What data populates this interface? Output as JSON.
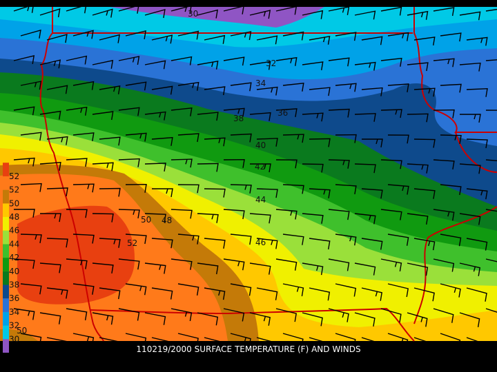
{
  "caption": "110219/2000 SURFACE TEMPERATURE (F) AND WINDS",
  "legend": [
    {
      "value": "30",
      "color": "#8f55c4"
    },
    {
      "value": "30",
      "color": "#00c9e6"
    },
    {
      "value": "32",
      "color": "#00a2e8"
    },
    {
      "value": "34",
      "color": "#2a73d6"
    },
    {
      "value": "36",
      "color": "#0e4a8c"
    },
    {
      "value": "38",
      "color": "#0a7a1e"
    },
    {
      "value": "40",
      "color": "#109a10"
    },
    {
      "value": "42",
      "color": "#3fc02c"
    },
    {
      "value": "44",
      "color": "#9ae03a"
    },
    {
      "value": "46",
      "color": "#f0f000"
    },
    {
      "value": "48",
      "color": "#ffc800"
    },
    {
      "value": "50",
      "color": "#c47a08"
    },
    {
      "value": "52",
      "color": "#ff7a1a"
    },
    {
      "value": "52",
      "color": "#e84010"
    }
  ],
  "contour_labels": [
    {
      "text": "30"
    },
    {
      "text": "32"
    },
    {
      "text": "34"
    },
    {
      "text": "36"
    },
    {
      "text": "38"
    },
    {
      "text": "40"
    },
    {
      "text": "42"
    },
    {
      "text": "44"
    },
    {
      "text": "46"
    },
    {
      "text": "48"
    },
    {
      "text": "50"
    },
    {
      "text": "52"
    },
    {
      "text": "50"
    }
  ],
  "colors": {
    "border": "#cc0000",
    "barb": "#000000",
    "background": "#000000",
    "caption": "#ffffff"
  }
}
